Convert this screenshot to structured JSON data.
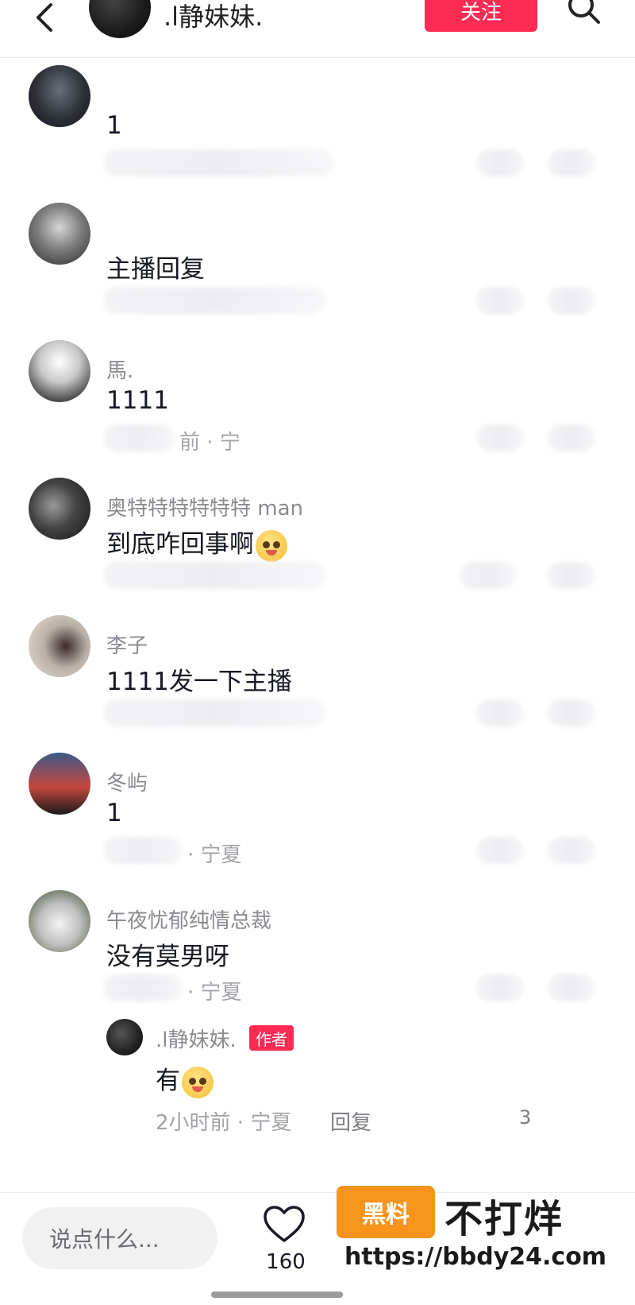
{
  "header": {
    "title": ".l静妹妹.",
    "follow_label": "关注"
  },
  "comments": [
    {
      "name": "",
      "text": "1",
      "meta": ""
    },
    {
      "name": "",
      "text": "主播回复",
      "meta": ""
    },
    {
      "name": "馬.",
      "text": "1111",
      "meta": "前 · 宁"
    },
    {
      "name": "奥特特特特特特 man",
      "text": "到底咋回事啊",
      "meta": ""
    },
    {
      "name": "李子",
      "text": "1111发一下主播",
      "meta": ""
    },
    {
      "name": "冬屿",
      "text": "1",
      "meta": "· 宁夏"
    },
    {
      "name": "午夜忧郁纯情总裁",
      "text": "没有莫男呀",
      "meta": "· 宁夏"
    }
  ],
  "reply": {
    "name": ".l静妹妹.",
    "badge": "作者",
    "text": "有",
    "meta": "2小时前 · 宁夏",
    "reply_label": "回复",
    "count": "3"
  },
  "bottom": {
    "input_placeholder": "说点什么...",
    "like_count": "160"
  },
  "watermark": {
    "box": "黑料",
    "big": "不打烊",
    "url": "https://bbdy24.com"
  },
  "colors": {
    "accent": "#fe2c55",
    "secondary_text": "#8a8b91"
  }
}
